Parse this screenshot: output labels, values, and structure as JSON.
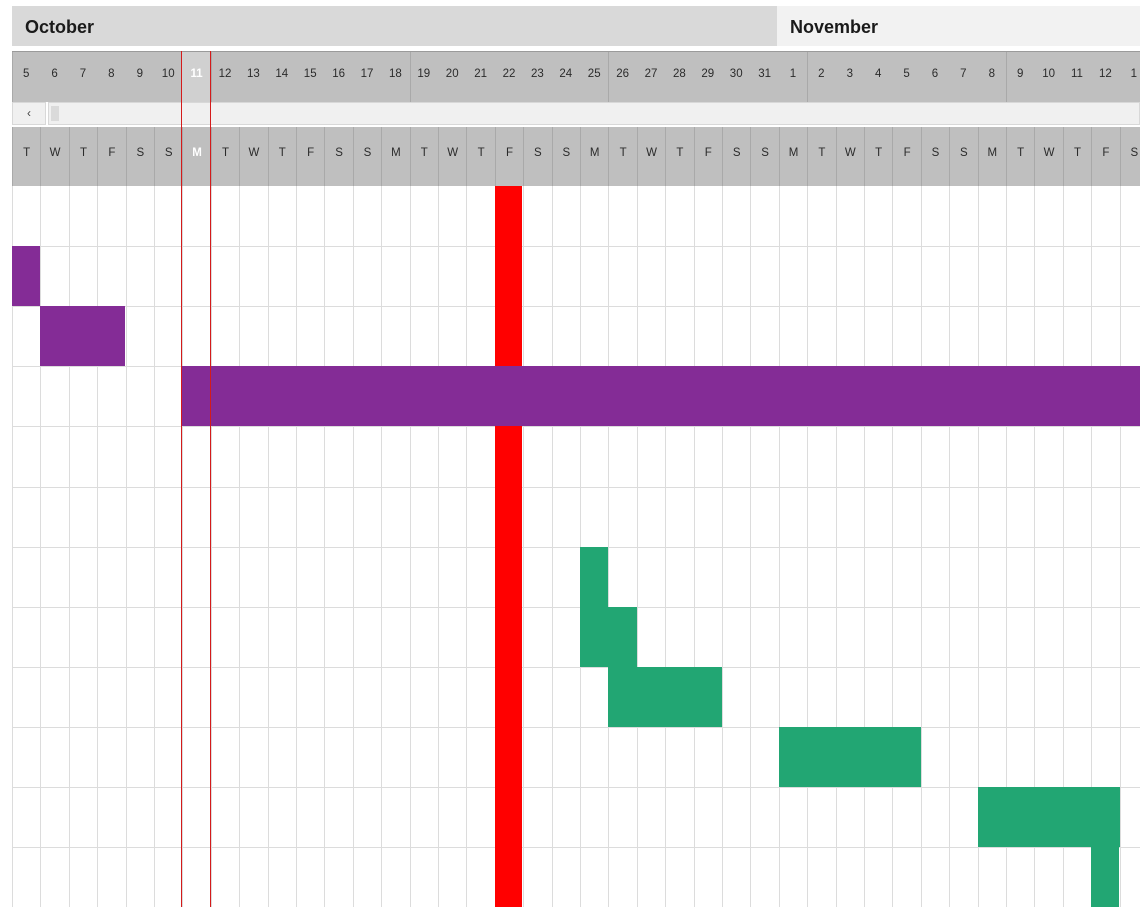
{
  "chart_data": {
    "type": "gantt",
    "months": [
      {
        "name": "October",
        "first_day": 5,
        "last_day": 31
      },
      {
        "name": "November",
        "first_day": 1,
        "last_day": 12
      }
    ],
    "day_numbers": [
      "5",
      "6",
      "7",
      "8",
      "9",
      "10",
      "11",
      "12",
      "13",
      "14",
      "15",
      "16",
      "17",
      "18",
      "19",
      "20",
      "21",
      "22",
      "23",
      "24",
      "25",
      "26",
      "27",
      "28",
      "29",
      "30",
      "31",
      "1",
      "2",
      "3",
      "4",
      "5",
      "6",
      "7",
      "8",
      "9",
      "10",
      "11",
      "12"
    ],
    "day_letters": [
      "T",
      "W",
      "T",
      "F",
      "S",
      "S",
      "M",
      "T",
      "W",
      "T",
      "F",
      "S",
      "S",
      "M",
      "T",
      "W",
      "T",
      "F",
      "S",
      "S",
      "M",
      "T",
      "W",
      "T",
      "F",
      "S",
      "S",
      "M",
      "T",
      "W",
      "T",
      "F",
      "S",
      "S",
      "M",
      "T",
      "W",
      "T",
      "F",
      "S"
    ],
    "trailing_day_number": "1",
    "today_label": "11",
    "today_index": 6,
    "highlight_column_index": 17,
    "row_count": 12,
    "tasks": [
      {
        "row": 1,
        "start": "Oct 5",
        "end": "Oct 5",
        "color": "#8a2e9a"
      },
      {
        "row": 2,
        "start": "Oct 6",
        "end": "Oct 8",
        "color": "#8a2e9a"
      },
      {
        "row": 3,
        "start": "Oct 11",
        "end": "Nov 12+",
        "color": "#8a2e9a"
      },
      {
        "row": 6,
        "start": "Oct 25",
        "end": "Oct 25",
        "color": "#22a673"
      },
      {
        "row": 7,
        "start": "Oct 25",
        "end": "Oct 26",
        "color": "#22a673"
      },
      {
        "row": 8,
        "start": "Oct 26",
        "end": "Oct 29",
        "color": "#22a673"
      },
      {
        "row": 9,
        "start": "Nov 1",
        "end": "Nov 5",
        "color": "#22a673"
      },
      {
        "row": 10,
        "start": "Nov 8",
        "end": "Nov 11",
        "color": "#22a673"
      },
      {
        "row": 11,
        "start": "Nov 11",
        "end": "Nov 11",
        "color": "#22a673"
      }
    ],
    "colors": {
      "purple": "#842c96",
      "green": "#22a673",
      "highlight": "#ff0000",
      "today_line": "#d41b1b",
      "header": "#bfbfbf"
    }
  }
}
